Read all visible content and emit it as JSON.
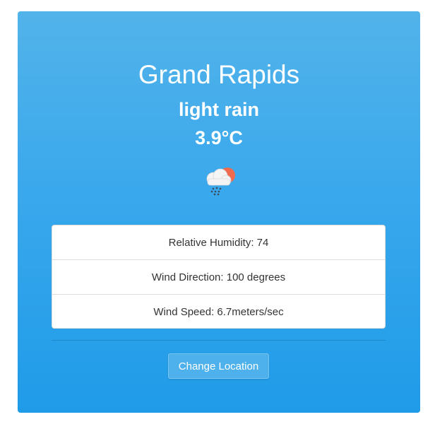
{
  "weather": {
    "city": "Grand Rapids",
    "description": "light rain",
    "temperature": "3.9°C",
    "icon": "cloud-sun-rain-icon"
  },
  "details": {
    "rows": [
      {
        "label": "Relative Humidity: 74"
      },
      {
        "label": "Wind Direction: 100 degrees"
      },
      {
        "label": "Wind Speed: 6.7meters/sec"
      }
    ]
  },
  "actions": {
    "change_location_label": "Change Location"
  },
  "colors": {
    "card_top": "#52b3ea",
    "card_bottom": "#1f9be8",
    "sun": "#f06b4e",
    "cloud": "#f4f4f4",
    "rain": "#3b4a5a"
  }
}
